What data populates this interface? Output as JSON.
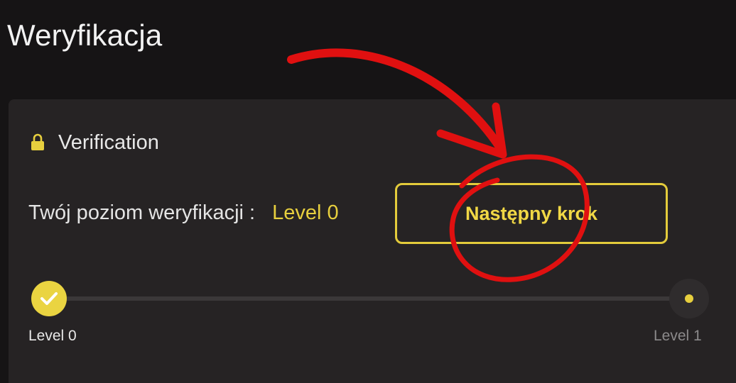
{
  "page": {
    "title": "Weryfikacja"
  },
  "card": {
    "icon": "lock-icon",
    "title": "Verification",
    "level_label": "Twój poziom weryfikacji :",
    "level_value": "Level 0",
    "next_step_label": "Następny krok"
  },
  "progress": {
    "steps": [
      {
        "label": "Level 0",
        "state": "completed"
      },
      {
        "label": "Level 1",
        "state": "pending"
      }
    ],
    "fill": 0
  },
  "colors": {
    "background": "#161415",
    "card": "#262324",
    "accent": "#e7cf3e",
    "annotation": "#e01010"
  }
}
